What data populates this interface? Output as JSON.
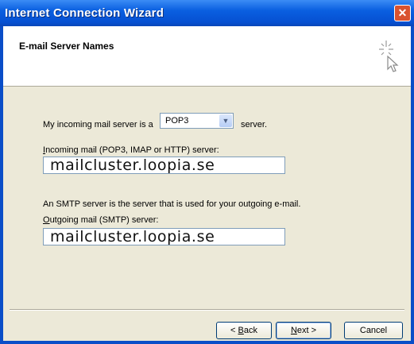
{
  "window": {
    "title": "Internet Connection Wizard",
    "close_glyph": "✕"
  },
  "header": {
    "title": "E-mail Server Names",
    "icon": "wizard-wand-icon"
  },
  "incoming_type": {
    "prefix": "My incoming mail server is a",
    "selected": "POP3",
    "suffix": "server."
  },
  "incoming": {
    "label_prefix": "",
    "label_key": "I",
    "label_rest": "ncoming mail (POP3, IMAP or HTTP) server:",
    "value": "mailcluster.loopia.se"
  },
  "smtp_note": "An SMTP server is the server that is used for your outgoing e-mail.",
  "outgoing": {
    "label_key": "O",
    "label_rest": "utgoing mail (SMTP) server:",
    "value": "mailcluster.loopia.se"
  },
  "buttons": {
    "back_prefix": "< ",
    "back_key": "B",
    "back_rest": "ack",
    "next_key": "N",
    "next_rest": "ext >",
    "cancel": "Cancel"
  },
  "colors": {
    "titlebar": "#0a5fe0",
    "dialog_bg": "#ece9d8",
    "close": "#d9532f"
  }
}
